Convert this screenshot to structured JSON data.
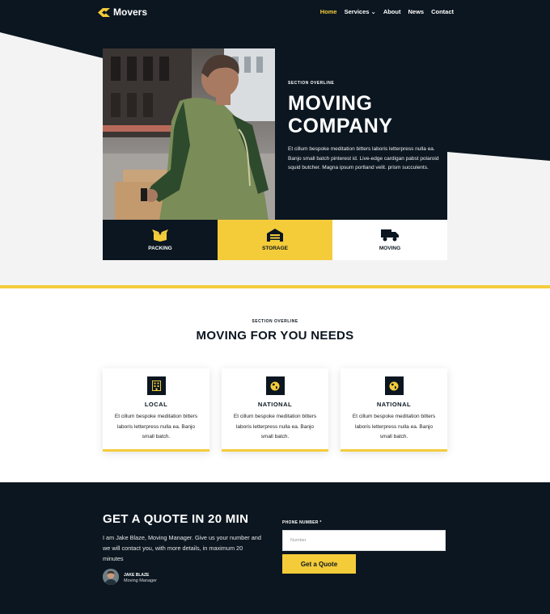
{
  "brand": {
    "name": "Movers",
    "accent": "#f4cc3a",
    "dark": "#0b1620"
  },
  "nav": {
    "items": [
      {
        "label": "Home",
        "active": true
      },
      {
        "label": "Services ⌄",
        "active": false
      },
      {
        "label": "About",
        "active": false
      },
      {
        "label": "News",
        "active": false
      },
      {
        "label": "Contact",
        "active": false
      }
    ]
  },
  "hero": {
    "overline": "SECTION OVERLINE",
    "title_line1": "MOVING",
    "title_line2": "COMPANY",
    "description": "Et cillum bespoke meditation bitters laboris letterpress nulla ea. Banjo small batch pinterest id. Live-edge cardigan pabst polaroid squid butcher. Magna ipsum portland velit. prism succulents.",
    "tiles": [
      {
        "label": "PACKING",
        "icon": "box-icon"
      },
      {
        "label": "STORAGE",
        "icon": "warehouse-icon"
      },
      {
        "label": "MOVING",
        "icon": "truck-icon"
      }
    ]
  },
  "services": {
    "overline": "SECTION OVERLINE",
    "title": "MOVING FOR YOU NEEDS",
    "cards": [
      {
        "title": "LOCAL",
        "text": "Et cillum bespoke meditation bitters laboris letterpress nulla ea. Banjo small batch.",
        "icon": "building-icon"
      },
      {
        "title": "NATIONAL",
        "text": "Et cillum bespoke meditation bitters laboris letterpress nulla ea. Banjo small batch.",
        "icon": "globe-icon"
      },
      {
        "title": "NATIONAL",
        "text": "Et cillum bespoke meditation bitters laboris letterpress nulla ea. Banjo small batch.",
        "icon": "globe-icon"
      }
    ]
  },
  "quote": {
    "title": "GET A QUOTE IN 20 MIN",
    "description": "I am Jake Blaze, Moving Manager. Give us your number and we will contact you, with more details, in maximum 20 minutes",
    "person_name": "JAKE BLAZE",
    "person_role": "Moving Manager",
    "phone_label": "PHONE NUMBER *",
    "phone_placeholder": "Number",
    "button_label": "Get a Quote"
  }
}
